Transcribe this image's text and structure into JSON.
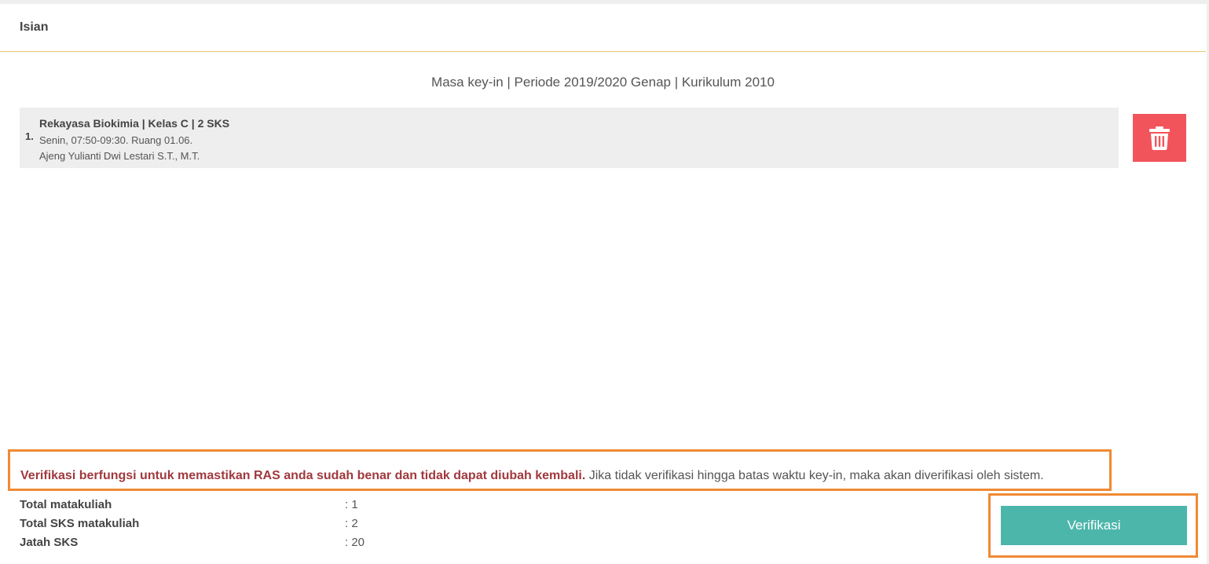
{
  "panel": {
    "title": "Isian"
  },
  "period": {
    "text": "Masa key-in | Periode 2019/2020 Genap | Kurikulum 2010"
  },
  "courses": [
    {
      "number": "1.",
      "title": "Rekayasa Biokimia | Kelas C | 2 SKS",
      "schedule": "Senin, 07:50-09:30. Ruang 01.06.",
      "lecturer": "Ajeng Yulianti Dwi Lestari S.T., M.T."
    }
  ],
  "actions": {
    "delete_icon": "trash-icon",
    "verify_label": "Verifikasi"
  },
  "notice": {
    "strong": "Verifikasi berfungsi untuk memastikan RAS anda sudah benar dan tidak dapat diubah kembali.",
    "rest": " Jika tidak verifikasi hingga batas waktu key-in, maka akan diverifikasi oleh sistem."
  },
  "summary": [
    {
      "label": "Total matakuliah",
      "value": ": 1"
    },
    {
      "label": "Total SKS matakuliah",
      "value": ": 2"
    },
    {
      "label": "Jatah SKS",
      "value": ": 20"
    }
  ],
  "colors": {
    "delete": "#f2545b",
    "verify": "#4cb6ab",
    "highlight": "#f08a34",
    "notice_strong": "#a0393d",
    "header_rule": "#e8c76a"
  }
}
